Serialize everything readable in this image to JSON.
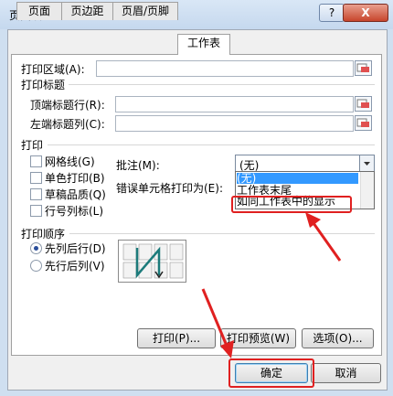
{
  "window": {
    "title": "页面设置",
    "help": "?",
    "close": "X"
  },
  "tabs": [
    {
      "label": "页面",
      "active": false
    },
    {
      "label": "页边距",
      "active": false
    },
    {
      "label": "页眉/页脚",
      "active": false
    },
    {
      "label": "工作表",
      "active": true
    }
  ],
  "print_area": {
    "label": "打印区域(A):",
    "value": ""
  },
  "print_titles": {
    "heading": "打印标题",
    "top_row_label": "顶端标题行(R):",
    "left_col_label": "左端标题列(C):"
  },
  "print": {
    "heading": "打印",
    "checkboxes": [
      {
        "label": "网格线(G)",
        "checked": false
      },
      {
        "label": "单色打印(B)",
        "checked": false
      },
      {
        "label": "草稿品质(Q)",
        "checked": false
      },
      {
        "label": "行号列标(L)",
        "checked": false
      }
    ],
    "comments_label": "批注(M):",
    "comments_value": "(无)",
    "errors_label": "错误单元格打印为(E):",
    "error_options": [
      "(无)",
      "工作表末尾",
      "如同工作表中的显示"
    ],
    "error_selected": "(无)"
  },
  "page_order": {
    "heading": "打印顺序",
    "options": [
      {
        "label": "先列后行(D)",
        "selected": true
      },
      {
        "label": "先行后列(V)",
        "selected": false
      }
    ]
  },
  "buttons": {
    "print": "打印(P)...",
    "preview": "打印预览(W)",
    "options": "选项(O)...",
    "ok": "确定",
    "cancel": "取消"
  },
  "colors": {
    "annotation": "#e02020",
    "selection": "#3399ff"
  }
}
